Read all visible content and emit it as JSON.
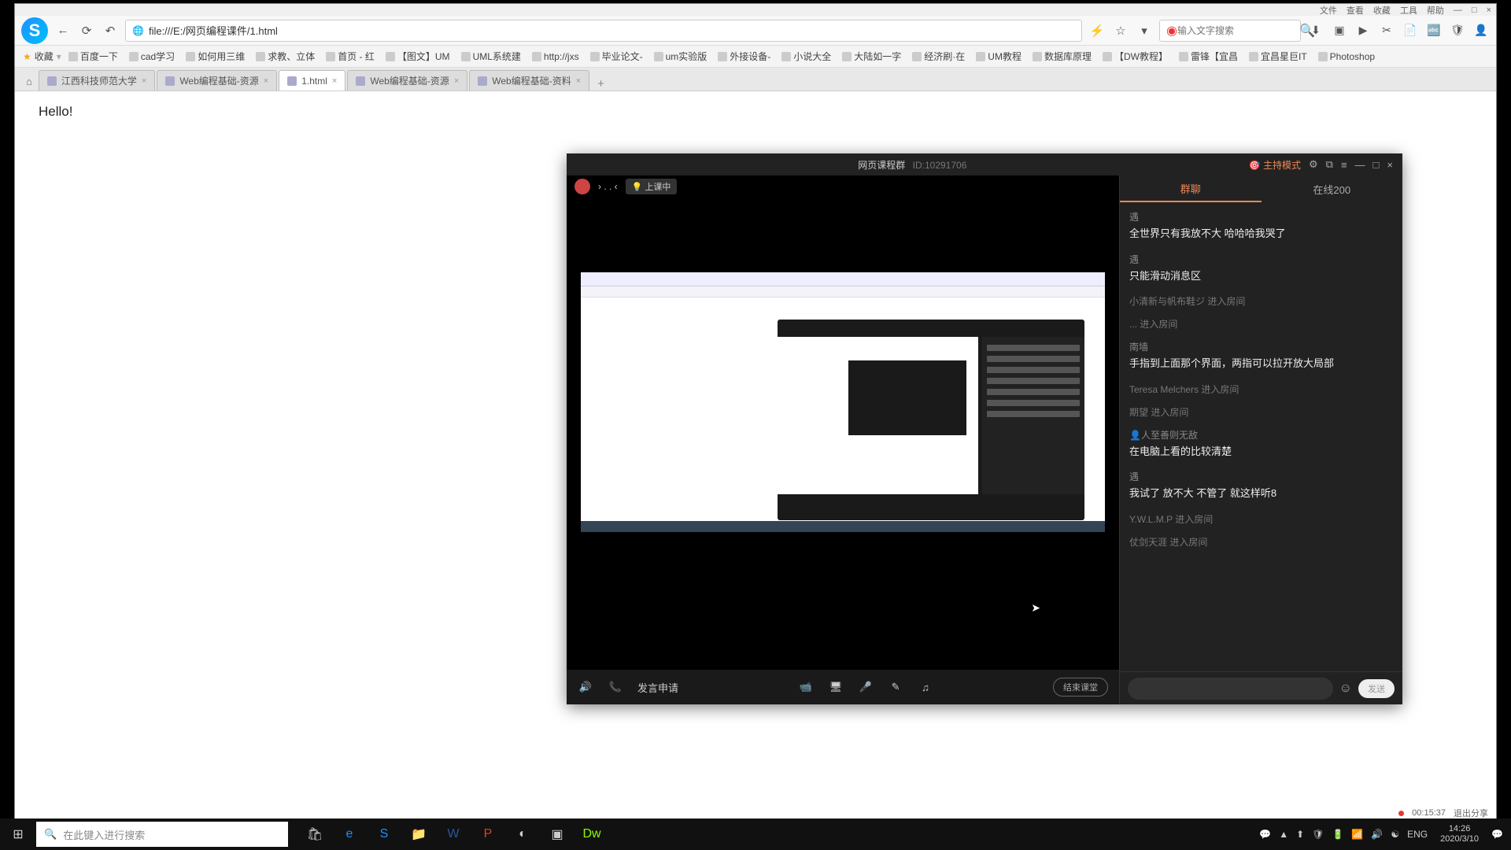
{
  "titleBar": {
    "items": [
      "文件",
      "查看",
      "收藏",
      "工具",
      "帮助",
      "—",
      "□",
      "×"
    ]
  },
  "address": {
    "url": "file:///E:/网页编程课件/1.html",
    "searchPlaceholder": "输入文字搜索"
  },
  "bookmarks": {
    "favLabel": "收藏",
    "items": [
      "百度一下",
      "cad学习",
      "如何用三维",
      "求教、立体",
      "首页 - 红",
      "【图文】UM",
      "UML系统建",
      "http://jxs",
      "毕业论文-",
      "um实验版",
      "外接设备-",
      "小说大全",
      "大陆如一字",
      "经济刷·在",
      "UM教程",
      "数据库原理",
      "【DW教程】",
      "雷锋【宜昌",
      "宜昌星巨IT",
      "Photoshop"
    ]
  },
  "tabs": {
    "items": [
      {
        "label": "江西科技师范大学",
        "active": false
      },
      {
        "label": "Web编程基础-资源",
        "active": false
      },
      {
        "label": "1.html",
        "active": true
      },
      {
        "label": "Web编程基础-资源",
        "active": false
      },
      {
        "label": "Web编程基础-资料",
        "active": false
      }
    ]
  },
  "page": {
    "hello": "Hello!"
  },
  "chat": {
    "title": "网页课程群",
    "roomId": "ID:10291706",
    "hostBadge": "主持模式",
    "classStatus": "上课中",
    "tabs": {
      "chat": "群聊",
      "online": "在线200"
    },
    "messages": [
      {
        "type": "msg",
        "user": "遇",
        "text": "全世界只有我放不大 哈哈哈我哭了"
      },
      {
        "type": "msg",
        "user": "遇",
        "text": "只能滑动消息区"
      },
      {
        "type": "sys",
        "text": "小清新与帆布鞋ジ 进入房间"
      },
      {
        "type": "sys",
        "text": "... 进入房间"
      },
      {
        "type": "msg",
        "user": "南墙",
        "text": "手指到上面那个界面，两指可以拉开放大局部"
      },
      {
        "type": "sys",
        "text": "Teresa Melchers 进入房间"
      },
      {
        "type": "sys",
        "text": "期望 进入房间"
      },
      {
        "type": "msg",
        "user": "👤人至善则无敌",
        "text": "在电脑上看的比较清楚"
      },
      {
        "type": "msg",
        "user": "遇",
        "text": "我试了 放不大 不管了 就这样听8"
      },
      {
        "type": "sys",
        "text": "Y.W.L.M.P 进入房间"
      },
      {
        "type": "sys",
        "text": "仗剑天涯 进入房间"
      }
    ],
    "sendLabel": "发送",
    "endLabel": "结束课堂",
    "speakReq": "发言申请"
  },
  "browserStatus": {
    "recTime": "00:15:37",
    "exit": "退出分享"
  },
  "taskbar": {
    "searchPlaceholder": "在此键入进行搜索",
    "lang": "ENG",
    "time": "14:26",
    "date": "2020/3/10"
  }
}
